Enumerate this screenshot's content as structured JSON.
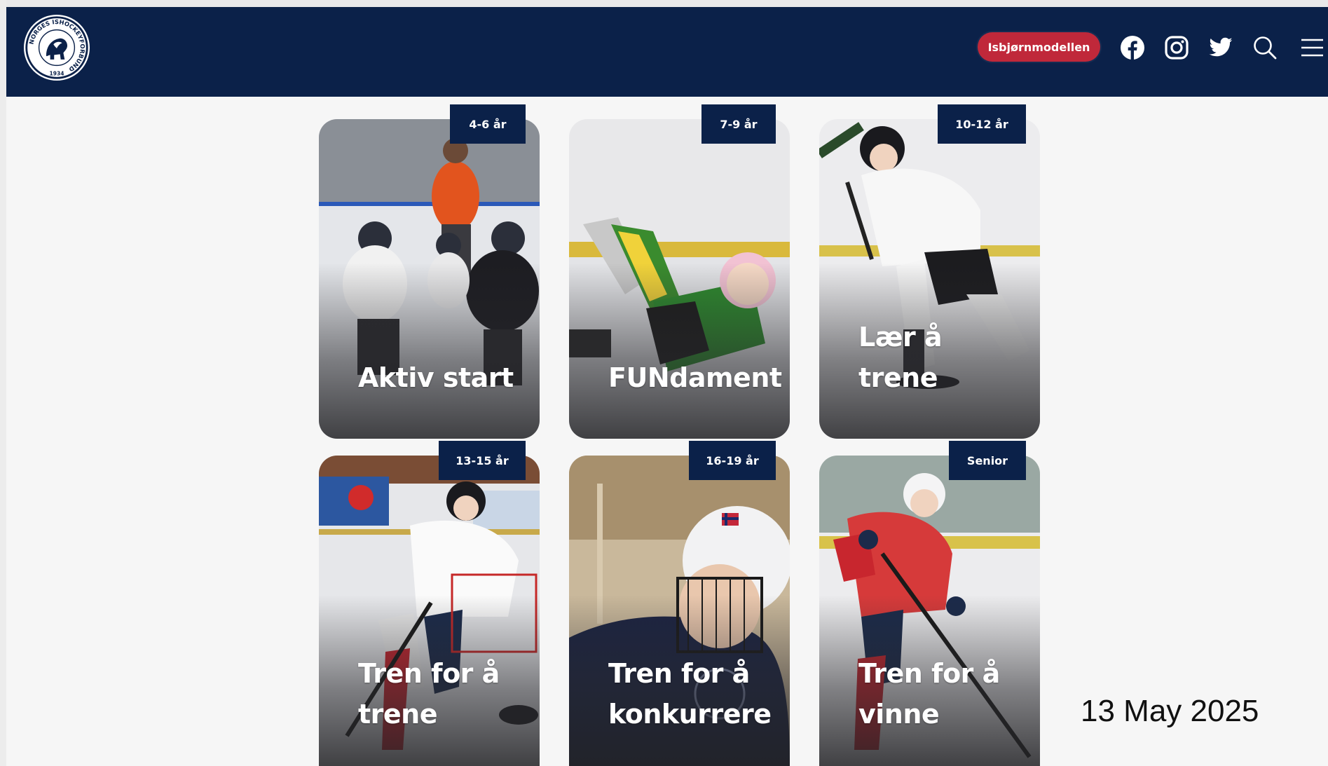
{
  "header": {
    "logo_label": "Norges Ishockeyforbund logo",
    "logo_text_ring": "NORGES ISHOCKEYFORBUND",
    "logo_year": "1934",
    "cta_label": "Isbjørnmodellen",
    "icons": [
      "facebook-icon",
      "instagram-icon",
      "twitter-icon",
      "search-icon",
      "menu-icon"
    ],
    "colors": {
      "nav": "#0b2149",
      "cta": "#c0283a"
    }
  },
  "cards": [
    {
      "badge": "4-6 år",
      "title": "Aktiv start"
    },
    {
      "badge": "7-9 år",
      "title": "FUNdament"
    },
    {
      "badge": "10-12 år",
      "title": "Lær å trene"
    },
    {
      "badge": "13-15 år",
      "title": "Tren for å trene"
    },
    {
      "badge": "16-19 år",
      "title": "Tren for å konkurrere"
    },
    {
      "badge": "Senior",
      "title": "Tren for å vinne"
    }
  ],
  "date": "13 May 2025"
}
